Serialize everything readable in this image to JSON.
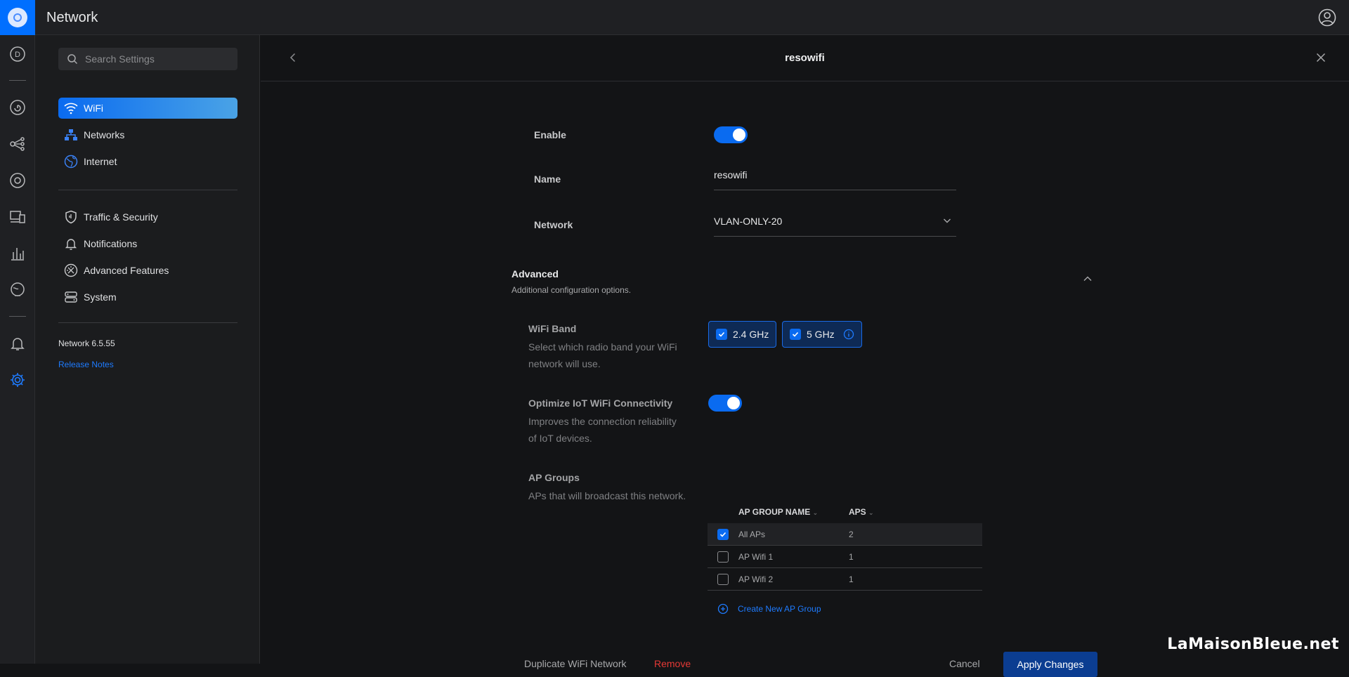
{
  "app": {
    "title": "Network"
  },
  "search": {
    "placeholder": "Search Settings"
  },
  "sidebar": {
    "items": [
      {
        "label": "WiFi",
        "icon": "wifi-icon",
        "active": true
      },
      {
        "label": "Networks",
        "icon": "networks-icon"
      },
      {
        "label": "Internet",
        "icon": "globe-icon"
      },
      {
        "label": "Traffic & Security",
        "icon": "shield-icon"
      },
      {
        "label": "Notifications",
        "icon": "bell-icon"
      },
      {
        "label": "Advanced Features",
        "icon": "advanced-icon"
      },
      {
        "label": "System",
        "icon": "system-icon"
      }
    ],
    "version": "Network 6.5.55",
    "release_notes": "Release Notes"
  },
  "rail": {
    "items": [
      "dashboard-icon",
      "topology-icon",
      "devices-icon",
      "clients-icon",
      "statistics-icon",
      "insights-icon",
      "alerts-icon",
      "settings-icon"
    ],
    "dashboard_letter": "D"
  },
  "header": {
    "title": "resowifi"
  },
  "form": {
    "enable_label": "Enable",
    "enable_on": true,
    "name_label": "Name",
    "name_value": "resowifi",
    "network_label": "Network",
    "network_value": "VLAN-ONLY-20"
  },
  "advanced": {
    "title": "Advanced",
    "subtitle": "Additional configuration options.",
    "wifi_band": {
      "title": "WiFi Band",
      "desc": "Select which radio band your WiFi network will use.",
      "bands": [
        "2.4 GHz",
        "5 GHz"
      ]
    },
    "iot": {
      "title": "Optimize IoT WiFi Connectivity",
      "desc": "Improves the connection reliability of IoT devices.",
      "on": true
    },
    "ap_groups": {
      "title": "AP Groups",
      "desc": "APs that will broadcast this network.",
      "col_name": "AP GROUP NAME",
      "col_aps": "APS",
      "rows": [
        {
          "name": "All APs",
          "aps": "2",
          "checked": true
        },
        {
          "name": "AP Wifi 1",
          "aps": "1",
          "checked": false
        },
        {
          "name": "AP Wifi 2",
          "aps": "1",
          "checked": false
        }
      ],
      "create": "Create New AP Group"
    }
  },
  "footer": {
    "duplicate": "Duplicate WiFi Network",
    "remove": "Remove",
    "cancel": "Cancel",
    "apply": "Apply Changes"
  },
  "watermark": "LaMaisonBleue.net",
  "colors": {
    "accent": "#0a6bf0",
    "danger": "#e53935",
    "link": "#1e7bff"
  }
}
